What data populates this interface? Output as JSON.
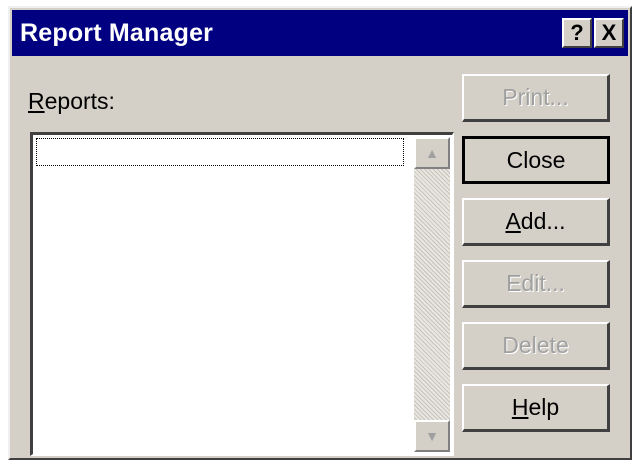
{
  "window": {
    "title": "Report Manager",
    "help_button": "?",
    "close_button": "X"
  },
  "reports": {
    "label_mnemonic": "R",
    "label_rest": "eports:",
    "items": []
  },
  "scrollbar": {
    "up_arrow": "▲",
    "down_arrow": "▼"
  },
  "buttons": {
    "print": "Print...",
    "close": "Close",
    "add_mnemonic": "A",
    "add_rest": "dd...",
    "edit": "Edit...",
    "delete": "Delete",
    "help_mnemonic": "H",
    "help_rest": "elp"
  }
}
